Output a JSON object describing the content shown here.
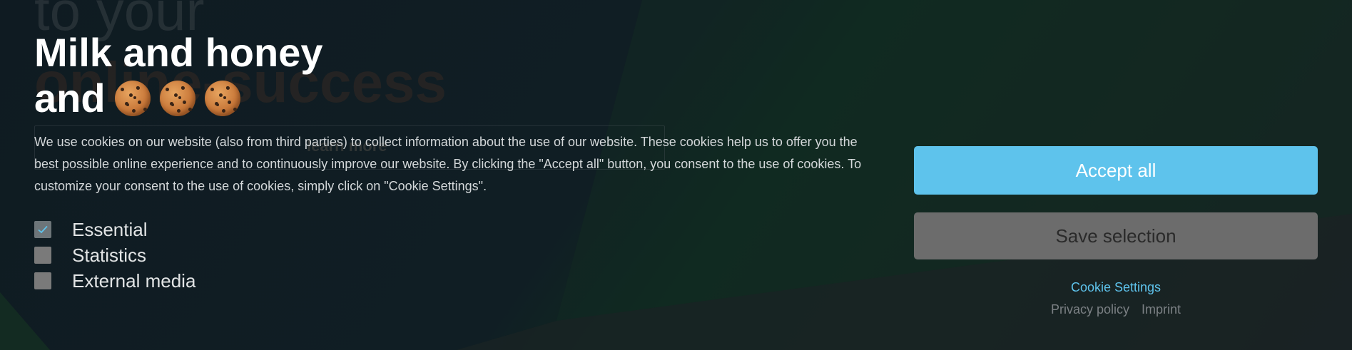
{
  "background": {
    "line1": "to your",
    "line2": "online-success",
    "button_label": "learn more"
  },
  "banner": {
    "title_line1": "Milk and honey",
    "title_line2": "and",
    "description": "We use cookies on our website (also from third parties) to collect information about the use of our website. These cookies help us to offer you the best possible online experience and to continuously improve our website. By clicking the \"Accept all\" button, you consent to the use of cookies. To customize your consent to the use of cookies, simply click on \"Cookie Settings\".",
    "options": [
      {
        "label": "Essential",
        "checked": true
      },
      {
        "label": "Statistics",
        "checked": false
      },
      {
        "label": "External media",
        "checked": false
      }
    ],
    "accept_all_label": "Accept all",
    "save_selection_label": "Save selection",
    "cookie_settings_label": "Cookie Settings",
    "privacy_policy_label": "Privacy policy",
    "imprint_label": "Imprint"
  },
  "colors": {
    "accent": "#5ec3ec",
    "secondary_button": "#6c6c6c",
    "background": "#0f1b22"
  },
  "icons": [
    "cookie-icon",
    "checkmark-icon"
  ]
}
